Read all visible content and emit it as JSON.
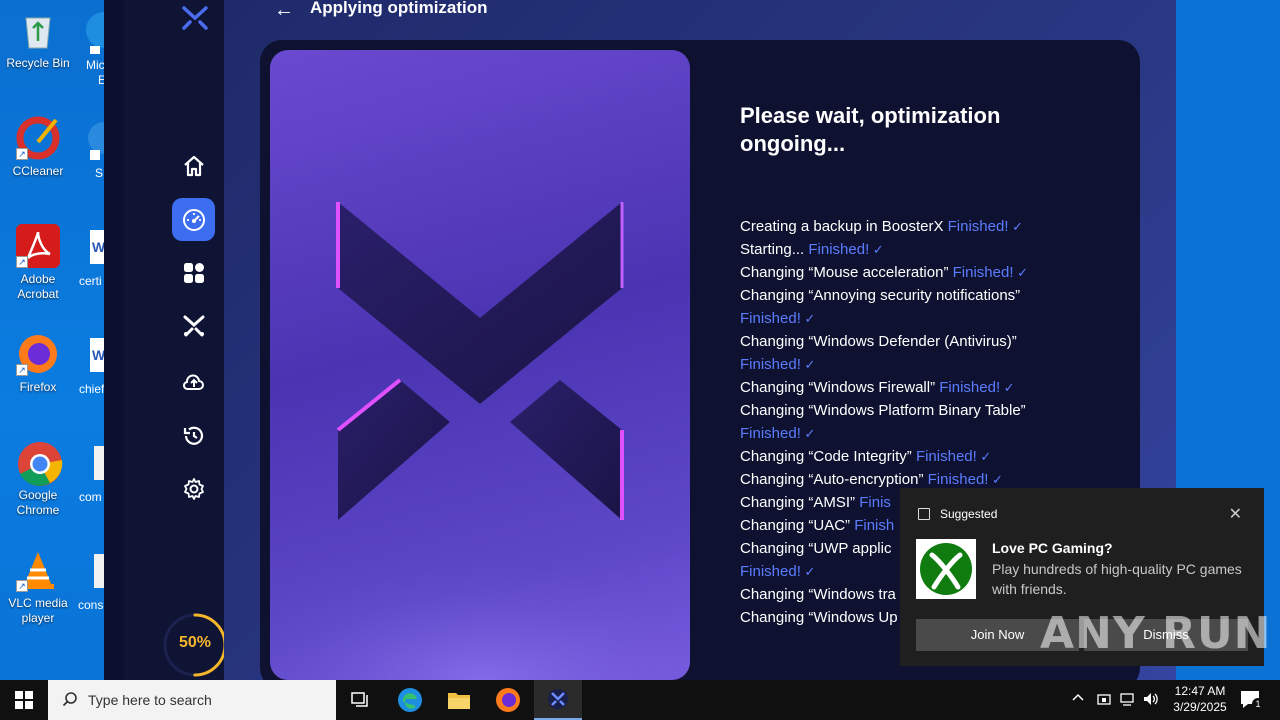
{
  "desktop": {
    "icons": [
      {
        "label": "Recycle Bin"
      },
      {
        "label": "CCleaner"
      },
      {
        "label": "Adobe Acrobat"
      },
      {
        "label": "Firefox"
      },
      {
        "label": "Google Chrome"
      },
      {
        "label": "VLC media player"
      }
    ],
    "partial_labels": [
      "Mic",
      "E",
      "S",
      "certi",
      "chief",
      "com",
      "cons"
    ]
  },
  "app": {
    "page_title": "Applying optimization",
    "heading": "Please wait, optimization ongoing...",
    "progress": {
      "value": 0.5,
      "label": "50%"
    },
    "finished_label": "Finished!",
    "log": [
      {
        "text": "Creating a backup in BoosterX",
        "status": "Finished!"
      },
      {
        "text": "Starting...",
        "status": "Finished!"
      },
      {
        "text": "Changing “Mouse acceleration”",
        "status": "Finished!"
      },
      {
        "text": "Changing “Annoying security notifications”",
        "status": "Finished!"
      },
      {
        "text": "Changing “Windows Defender (Antivirus)”",
        "status": "Finished!"
      },
      {
        "text": "Changing “Windows Firewall”",
        "status": "Finished!"
      },
      {
        "text": "Changing “Windows Platform Binary Table”",
        "status": "Finished!"
      },
      {
        "text": "Changing “Code Integrity”",
        "status": "Finished!"
      },
      {
        "text": "Changing “Auto-encryption”",
        "status": "Finished!"
      },
      {
        "text": "Changing “AMSI”",
        "status": "Finis"
      },
      {
        "text": "Changing “UAC”",
        "status": "Finish"
      },
      {
        "text": "Changing “UWP applic",
        "status": ""
      },
      {
        "text": "",
        "status": "Finished!"
      },
      {
        "text": "Changing “Windows tra",
        "status": ""
      },
      {
        "text": "Changing “Windows Up",
        "status": ""
      }
    ],
    "nav": [
      "home-icon",
      "speedometer-icon",
      "apps-icon",
      "boosterx-icon",
      "cloud-upload-icon",
      "history-icon",
      "settings-icon"
    ],
    "accent": "#3d6ef0",
    "progress_color": "#f5b62a"
  },
  "toast": {
    "header": "Suggested",
    "title": "Love PC Gaming?",
    "body": "Play hundreds of high-quality PC games with friends.",
    "join_label": "Join Now",
    "dismiss_label": "Dismiss",
    "close_glyph": "✕"
  },
  "watermark": "ANY RUN",
  "taskbar": {
    "search_placeholder": "Type here to search",
    "time": "12:47 AM",
    "date": "3/29/2025",
    "notification_count": "1"
  }
}
